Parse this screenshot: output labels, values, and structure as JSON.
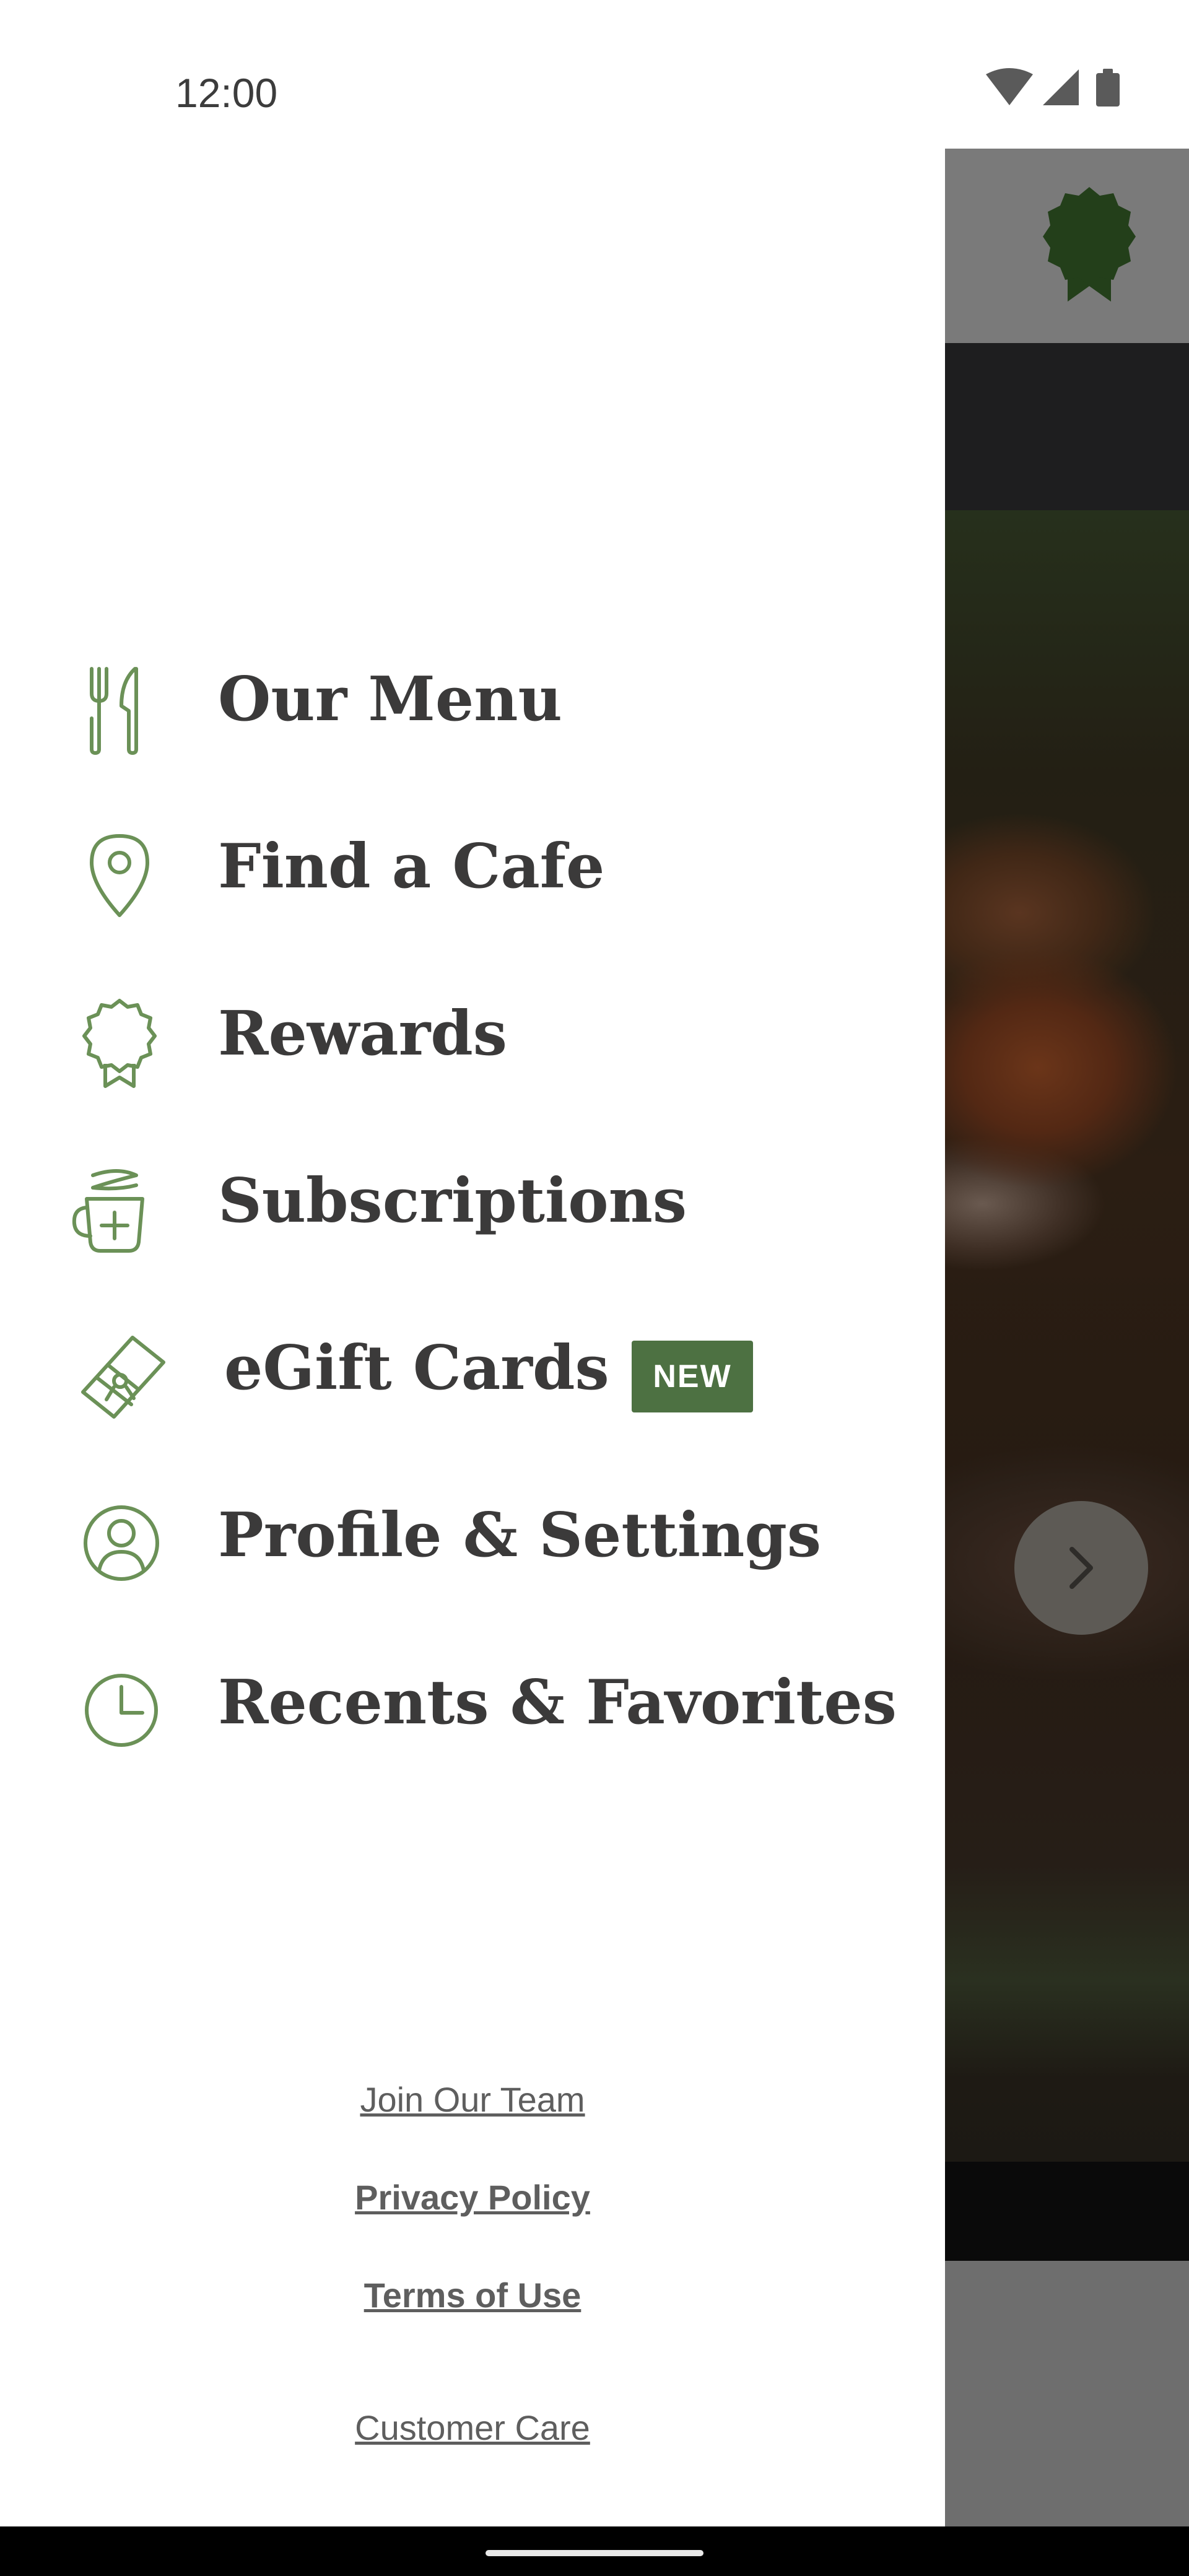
{
  "status_bar": {
    "time": "12:00",
    "icons": [
      "wifi-icon",
      "signal-icon",
      "battery-icon"
    ]
  },
  "drawer": {
    "items": [
      {
        "label": "Our Menu",
        "icon": "fork-knife-icon"
      },
      {
        "label": "Find a Cafe",
        "icon": "location-pin-icon"
      },
      {
        "label": "Rewards",
        "icon": "award-ribbon-icon"
      },
      {
        "label": "Subscriptions",
        "icon": "coffee-cup-plus-icon"
      },
      {
        "label": "eGift Cards",
        "icon": "gift-card-icon",
        "badge": "NEW"
      },
      {
        "label": "Profile & Settings",
        "icon": "user-profile-icon"
      },
      {
        "label": "Recents & Favorites",
        "icon": "clock-icon"
      }
    ],
    "footer_links": [
      "Join Our Team",
      "Privacy Policy",
      "Terms of Use",
      "Customer Care"
    ]
  },
  "background": {
    "header_icon": "rewards-badge-icon",
    "carousel_next_icon": "chevron-right-icon"
  },
  "colors": {
    "accent_green": "#4d7142",
    "icon_green": "#6b9157",
    "text_dark": "#3b3a3a",
    "footer_gray": "#5e5e5e"
  }
}
